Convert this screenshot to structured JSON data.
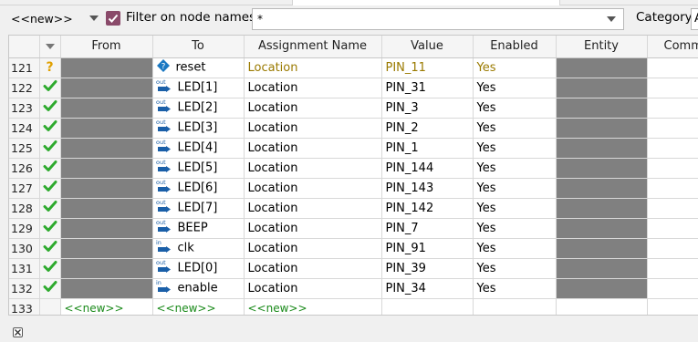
{
  "toolbar": {
    "new_combo": "<<new>>",
    "filter_label": "Filter on node names:",
    "filter_value": "*",
    "category_label": "Category:",
    "category_value": "A"
  },
  "columns": [
    "",
    "",
    "From",
    "To",
    "Assignment Name",
    "Value",
    "Enabled",
    "Entity",
    "Comm"
  ],
  "rows": [
    {
      "num": "121",
      "status": "warning",
      "to_icon": "unknown-pin-icon",
      "to": "reset",
      "assignment": "Location",
      "value": "PIN_11",
      "enabled": "Yes"
    },
    {
      "num": "122",
      "status": "ok",
      "to_icon": "output-pin-icon",
      "to": "LED[1]",
      "assignment": "Location",
      "value": "PIN_31",
      "enabled": "Yes"
    },
    {
      "num": "123",
      "status": "ok",
      "to_icon": "output-pin-icon",
      "to": "LED[2]",
      "assignment": "Location",
      "value": "PIN_3",
      "enabled": "Yes"
    },
    {
      "num": "124",
      "status": "ok",
      "to_icon": "output-pin-icon",
      "to": "LED[3]",
      "assignment": "Location",
      "value": "PIN_2",
      "enabled": "Yes"
    },
    {
      "num": "125",
      "status": "ok",
      "to_icon": "output-pin-icon",
      "to": "LED[4]",
      "assignment": "Location",
      "value": "PIN_1",
      "enabled": "Yes"
    },
    {
      "num": "126",
      "status": "ok",
      "to_icon": "output-pin-icon",
      "to": "LED[5]",
      "assignment": "Location",
      "value": "PIN_144",
      "enabled": "Yes"
    },
    {
      "num": "127",
      "status": "ok",
      "to_icon": "output-pin-icon",
      "to": "LED[6]",
      "assignment": "Location",
      "value": "PIN_143",
      "enabled": "Yes"
    },
    {
      "num": "128",
      "status": "ok",
      "to_icon": "output-pin-icon",
      "to": "LED[7]",
      "assignment": "Location",
      "value": "PIN_142",
      "enabled": "Yes"
    },
    {
      "num": "129",
      "status": "ok",
      "to_icon": "output-pin-icon",
      "to": "BEEP",
      "assignment": "Location",
      "value": "PIN_7",
      "enabled": "Yes"
    },
    {
      "num": "130",
      "status": "ok",
      "to_icon": "input-pin-icon",
      "to": "clk",
      "assignment": "Location",
      "value": "PIN_91",
      "enabled": "Yes"
    },
    {
      "num": "131",
      "status": "ok",
      "to_icon": "output-pin-icon",
      "to": "LED[0]",
      "assignment": "Location",
      "value": "PIN_39",
      "enabled": "Yes"
    },
    {
      "num": "132",
      "status": "ok",
      "to_icon": "input-pin-icon",
      "to": "enable",
      "assignment": "Location",
      "value": "PIN_34",
      "enabled": "Yes"
    }
  ],
  "new_row": {
    "num": "133",
    "from": "<<new>>",
    "to": "<<new>>",
    "assignment": "<<new>>"
  },
  "icons": {
    "out_label": "out",
    "in_label": "in",
    "warning_glyph": "?"
  },
  "colors": {
    "ok_check": "#2eaa2e",
    "warning_text": "#9a7a00",
    "new_text": "#1a8a1a",
    "empty_cell": "#808080"
  }
}
